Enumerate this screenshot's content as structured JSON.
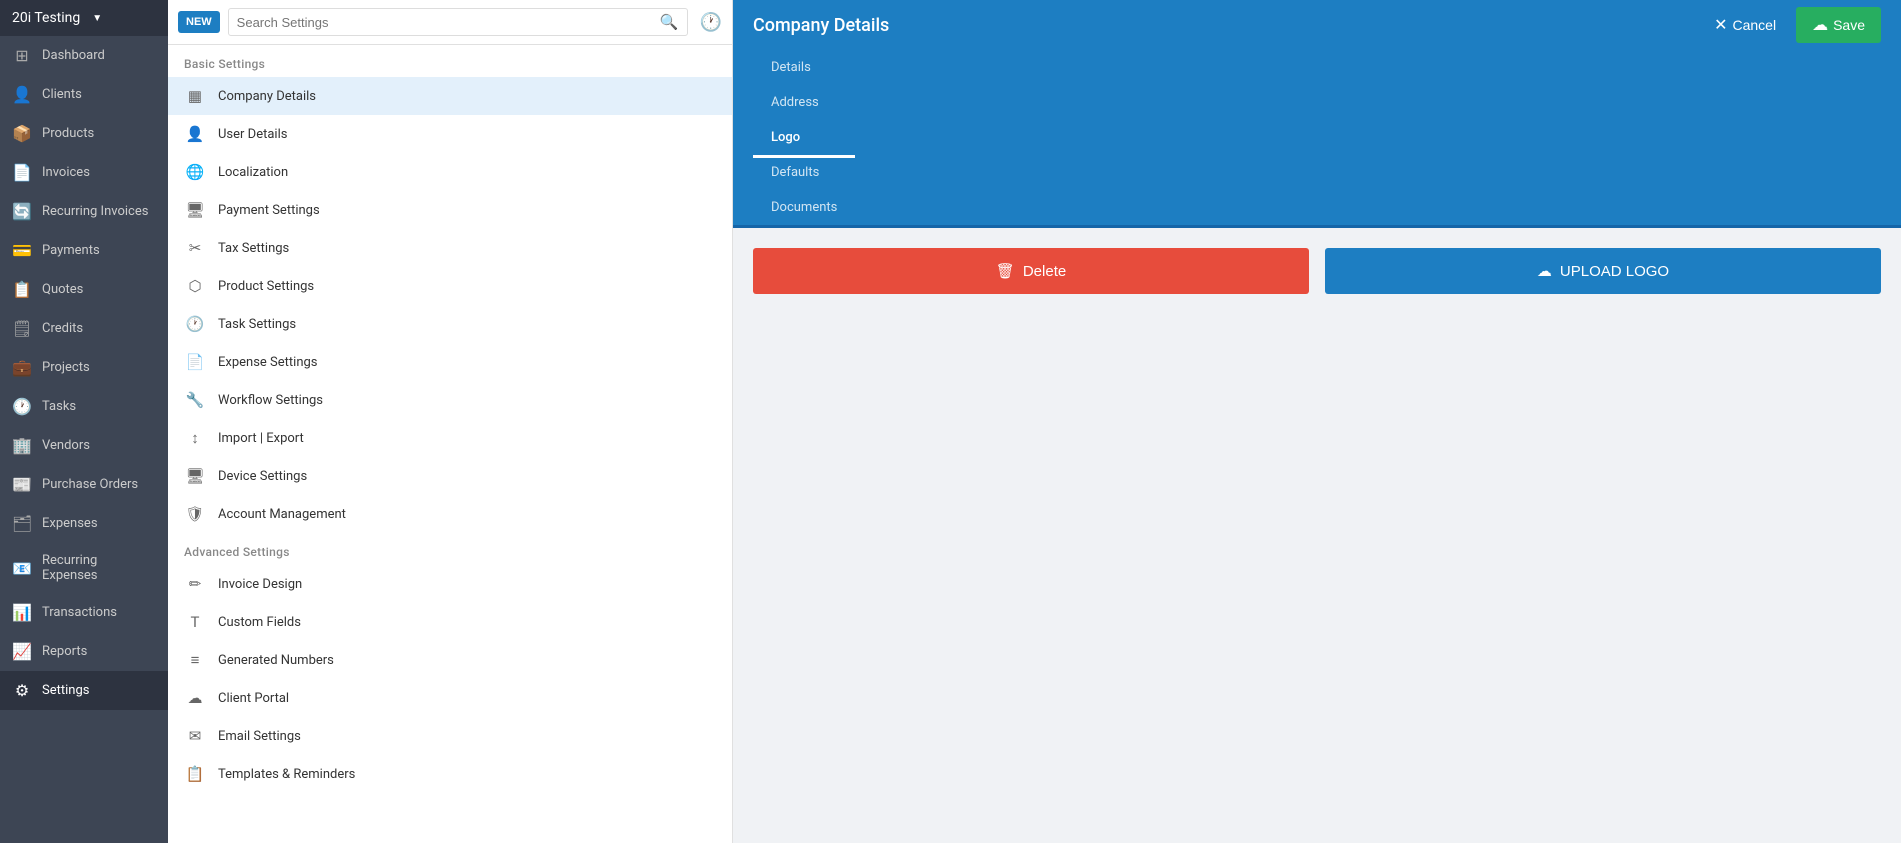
{
  "app": {
    "workspace": "20i Testing"
  },
  "nav": {
    "items": [
      {
        "id": "dashboard",
        "label": "Dashboard",
        "icon": "⊞"
      },
      {
        "id": "clients",
        "label": "Clients",
        "icon": "👤"
      },
      {
        "id": "products",
        "label": "Products",
        "icon": "📦"
      },
      {
        "id": "invoices",
        "label": "Invoices",
        "icon": "📄"
      },
      {
        "id": "recurring-invoices",
        "label": "Recurring Invoices",
        "icon": "🔄"
      },
      {
        "id": "payments",
        "label": "Payments",
        "icon": "💳"
      },
      {
        "id": "quotes",
        "label": "Quotes",
        "icon": "📋"
      },
      {
        "id": "credits",
        "label": "Credits",
        "icon": "🗒"
      },
      {
        "id": "projects",
        "label": "Projects",
        "icon": "💼"
      },
      {
        "id": "tasks",
        "label": "Tasks",
        "icon": "🕐"
      },
      {
        "id": "vendors",
        "label": "Vendors",
        "icon": "🏢"
      },
      {
        "id": "purchase-orders",
        "label": "Purchase Orders",
        "icon": "📰"
      },
      {
        "id": "expenses",
        "label": "Expenses",
        "icon": "🗂"
      },
      {
        "id": "recurring-expenses",
        "label": "Recurring Expenses",
        "icon": "📧"
      },
      {
        "id": "transactions",
        "label": "Transactions",
        "icon": "📊"
      },
      {
        "id": "reports",
        "label": "Reports",
        "icon": "📈"
      },
      {
        "id": "settings",
        "label": "Settings",
        "icon": "⚙"
      }
    ]
  },
  "settings_toolbar": {
    "new_button_label": "NEW",
    "search_placeholder": "Search Settings",
    "history_icon": "🕐"
  },
  "settings_sections": {
    "basic_header": "Basic Settings",
    "advanced_header": "Advanced Settings",
    "basic_items": [
      {
        "id": "company-details",
        "label": "Company Details",
        "icon": "▦"
      },
      {
        "id": "user-details",
        "label": "User Details",
        "icon": "👤"
      },
      {
        "id": "localization",
        "label": "Localization",
        "icon": "🌐"
      },
      {
        "id": "payment-settings",
        "label": "Payment Settings",
        "icon": "🖥"
      },
      {
        "id": "tax-settings",
        "label": "Tax Settings",
        "icon": "✂"
      },
      {
        "id": "product-settings",
        "label": "Product Settings",
        "icon": "⬡"
      },
      {
        "id": "task-settings",
        "label": "Task Settings",
        "icon": "🕐"
      },
      {
        "id": "expense-settings",
        "label": "Expense Settings",
        "icon": "📄"
      },
      {
        "id": "workflow-settings",
        "label": "Workflow Settings",
        "icon": "🔧"
      },
      {
        "id": "import-export",
        "label": "Import | Export",
        "icon": "↕"
      },
      {
        "id": "device-settings",
        "label": "Device Settings",
        "icon": "🖥"
      },
      {
        "id": "account-management",
        "label": "Account Management",
        "icon": "🛡"
      }
    ],
    "advanced_items": [
      {
        "id": "invoice-design",
        "label": "Invoice Design",
        "icon": "✏"
      },
      {
        "id": "custom-fields",
        "label": "Custom Fields",
        "icon": "T"
      },
      {
        "id": "generated-numbers",
        "label": "Generated Numbers",
        "icon": "≡"
      },
      {
        "id": "client-portal",
        "label": "Client Portal",
        "icon": "☁"
      },
      {
        "id": "email-settings",
        "label": "Email Settings",
        "icon": "✉"
      },
      {
        "id": "templates-reminders",
        "label": "Templates & Reminders",
        "icon": "📋"
      }
    ]
  },
  "main": {
    "title": "Company Details",
    "cancel_label": "Cancel",
    "save_label": "Save",
    "tabs": [
      {
        "id": "details",
        "label": "Details"
      },
      {
        "id": "address",
        "label": "Address"
      },
      {
        "id": "logo",
        "label": "Logo"
      },
      {
        "id": "defaults",
        "label": "Defaults"
      },
      {
        "id": "documents",
        "label": "Documents"
      }
    ],
    "active_tab": "logo",
    "delete_button_label": "Delete",
    "upload_button_label": "UPLOAD LOGO"
  }
}
